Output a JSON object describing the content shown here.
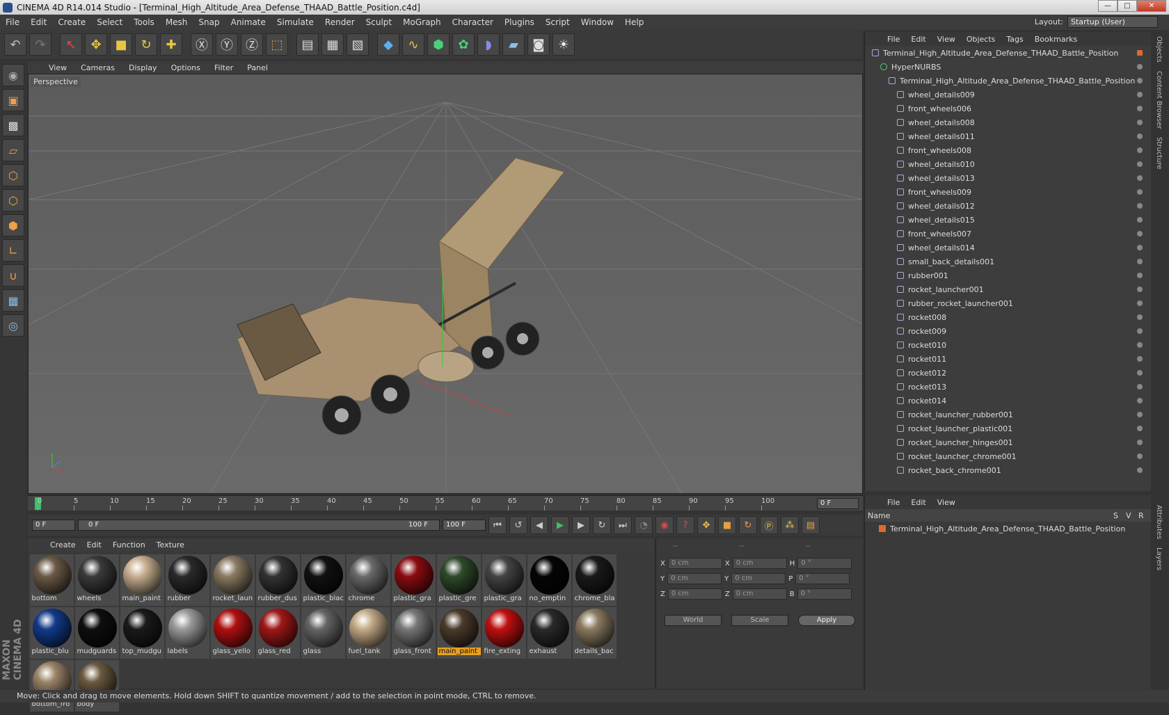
{
  "window": {
    "title": "CINEMA 4D R14.014 Studio - [Terminal_High_Altitude_Area_Defense_THAAD_Battle_Position.c4d]",
    "min": "—",
    "max": "□",
    "close": "✕"
  },
  "menu": [
    "File",
    "Edit",
    "Create",
    "Select",
    "Tools",
    "Mesh",
    "Snap",
    "Animate",
    "Simulate",
    "Render",
    "Sculpt",
    "MoGraph",
    "Character",
    "Plugins",
    "Script",
    "Window",
    "Help"
  ],
  "layout": {
    "label": "Layout:",
    "value": "Startup (User)"
  },
  "viewport": {
    "menu": [
      "View",
      "Cameras",
      "Display",
      "Options",
      "Filter",
      "Panel"
    ],
    "label": "Perspective"
  },
  "timeline": {
    "ticks": [
      "0",
      "5",
      "10",
      "15",
      "20",
      "25",
      "30",
      "35",
      "40",
      "45",
      "50",
      "55",
      "60",
      "65",
      "70",
      "75",
      "80",
      "85",
      "90",
      "95",
      "100"
    ],
    "current": "0 F"
  },
  "transport": {
    "start": "0 F",
    "range_start": "0 F",
    "range_end": "100 F",
    "end": "100 F"
  },
  "materials": {
    "menu": [
      "Create",
      "Edit",
      "Function",
      "Texture"
    ],
    "items": [
      {
        "name": "bottom",
        "color": "#6b5a46"
      },
      {
        "name": "wheels",
        "color": "#3a3a3a"
      },
      {
        "name": "main_paint",
        "color": "#c8b090"
      },
      {
        "name": "rubber",
        "color": "#2a2a2a"
      },
      {
        "name": "rocket_laun",
        "color": "#8a7a62"
      },
      {
        "name": "rubber_dus",
        "color": "#333333"
      },
      {
        "name": "plastic_blac",
        "color": "#111111"
      },
      {
        "name": "chrome",
        "color": "#6a6a6a"
      },
      {
        "name": "plastic_gra",
        "color": "#8a0c10"
      },
      {
        "name": "plastic_gre",
        "color": "#2f4a2a"
      },
      {
        "name": "plastic_gra",
        "color": "#444444"
      },
      {
        "name": "no_emptin",
        "color": "#050505"
      },
      {
        "name": "chrome_bla",
        "color": "#1a1a1a"
      },
      {
        "name": "plastic_blu",
        "color": "#123a8a"
      },
      {
        "name": "mudguards",
        "color": "#0e0e0e"
      },
      {
        "name": "top_mudgu",
        "color": "#1a1a1a"
      },
      {
        "name": "labels",
        "color": "#9a9a9a"
      },
      {
        "name": "glass_yello",
        "color": "#b01010"
      },
      {
        "name": "glass_red",
        "color": "#a01818"
      },
      {
        "name": "glass",
        "color": "#666666"
      },
      {
        "name": "fuel_tank",
        "color": "#c4ab88"
      },
      {
        "name": "glass_front",
        "color": "#777777"
      },
      {
        "name": "main_paint",
        "color": "#4a3a2a",
        "highlight": true
      },
      {
        "name": "fire_exting",
        "color": "#c01010"
      },
      {
        "name": "exhaust",
        "color": "#2a2a2a"
      },
      {
        "name": "details_bac",
        "color": "#8a7a60"
      },
      {
        "name": "bottom_fro",
        "color": "#9a8468"
      },
      {
        "name": "body",
        "color": "#6a5a40"
      }
    ]
  },
  "coords": {
    "headers": [
      "--",
      "--",
      "--"
    ],
    "rows": [
      {
        "a": "X",
        "av": "0 cm",
        "b": "X",
        "bv": "0 cm",
        "c": "H",
        "cv": "0 °"
      },
      {
        "a": "Y",
        "av": "0 cm",
        "b": "Y",
        "bv": "0 cm",
        "c": "P",
        "cv": "0 °"
      },
      {
        "a": "Z",
        "av": "0 cm",
        "b": "Z",
        "bv": "0 cm",
        "c": "B",
        "cv": "0 °"
      }
    ],
    "mode": "World",
    "scale": "Scale",
    "apply": "Apply"
  },
  "objects": {
    "menu": [
      "File",
      "Edit",
      "View",
      "Objects",
      "Tags",
      "Bookmarks"
    ],
    "rows": [
      {
        "name": "Terminal_High_Altitude_Area_Defense_THAAD_Battle_Position",
        "indent": 0,
        "top": true
      },
      {
        "name": "HyperNURBS",
        "indent": 1
      },
      {
        "name": "Terminal_High_Altitude_Area_Defense_THAAD_Battle_Position",
        "indent": 2
      },
      {
        "name": "wheel_details009",
        "indent": 3
      },
      {
        "name": "front_wheels006",
        "indent": 3
      },
      {
        "name": "wheel_details008",
        "indent": 3
      },
      {
        "name": "wheel_details011",
        "indent": 3
      },
      {
        "name": "front_wheels008",
        "indent": 3
      },
      {
        "name": "wheel_details010",
        "indent": 3
      },
      {
        "name": "wheel_details013",
        "indent": 3
      },
      {
        "name": "front_wheels009",
        "indent": 3
      },
      {
        "name": "wheel_details012",
        "indent": 3
      },
      {
        "name": "wheel_details015",
        "indent": 3
      },
      {
        "name": "front_wheels007",
        "indent": 3
      },
      {
        "name": "wheel_details014",
        "indent": 3
      },
      {
        "name": "small_back_details001",
        "indent": 3
      },
      {
        "name": "rubber001",
        "indent": 3
      },
      {
        "name": "rocket_launcher001",
        "indent": 3
      },
      {
        "name": "rubber_rocket_launcher001",
        "indent": 3
      },
      {
        "name": "rocket008",
        "indent": 3
      },
      {
        "name": "rocket009",
        "indent": 3
      },
      {
        "name": "rocket010",
        "indent": 3
      },
      {
        "name": "rocket011",
        "indent": 3
      },
      {
        "name": "rocket012",
        "indent": 3
      },
      {
        "name": "rocket013",
        "indent": 3
      },
      {
        "name": "rocket014",
        "indent": 3
      },
      {
        "name": "rocket_launcher_rubber001",
        "indent": 3
      },
      {
        "name": "rocket_launcher_plastic001",
        "indent": 3
      },
      {
        "name": "rocket_launcher_hinges001",
        "indent": 3
      },
      {
        "name": "rocket_launcher_chrome001",
        "indent": 3
      },
      {
        "name": "rocket_back_chrome001",
        "indent": 3
      }
    ]
  },
  "layers": {
    "menu": [
      "File",
      "Edit",
      "View"
    ],
    "columns": {
      "name": "Name",
      "s": "S",
      "v": "V",
      "r": "R"
    },
    "row": "Terminal_High_Altitude_Area_Defense_THAAD_Battle_Position"
  },
  "side_tabs": [
    "Objects",
    "Content Browser",
    "Structure"
  ],
  "side_tabs_lower": [
    "Attributes",
    "Layers"
  ],
  "status": "Move: Click and drag to move elements. Hold down SHIFT to quantize movement / add to the selection in point mode, CTRL to remove.",
  "logo": "MAXON CINEMA 4D"
}
